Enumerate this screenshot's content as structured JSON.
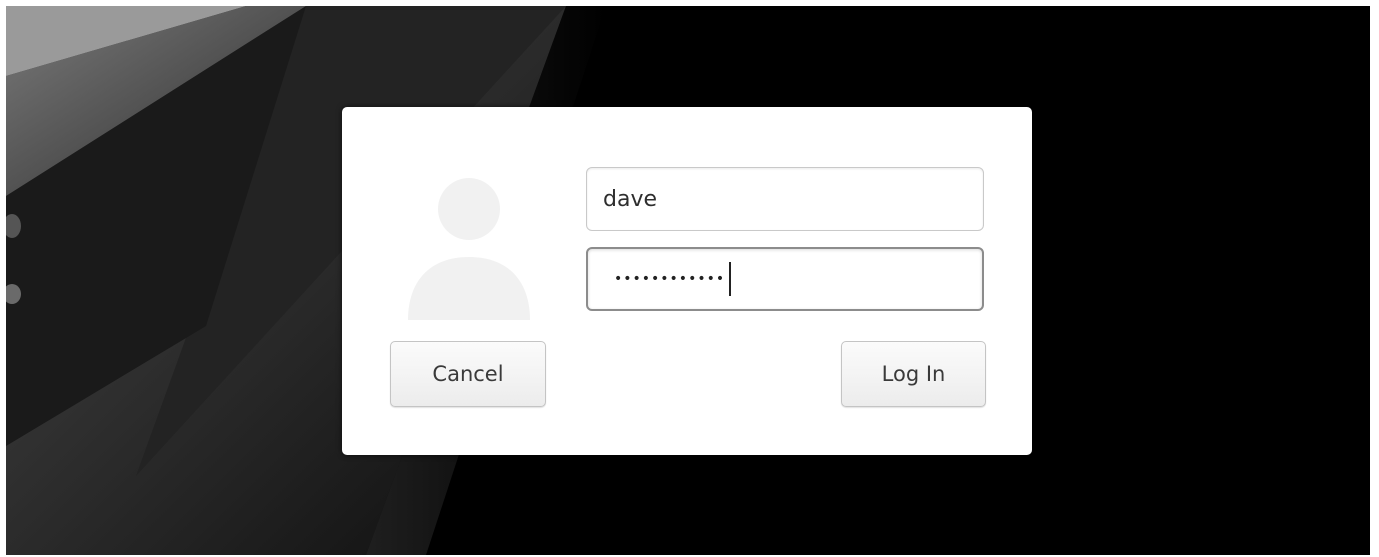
{
  "login_dialog": {
    "username_value": "dave",
    "password_mask": "••••••••••••",
    "cancel_label": "Cancel",
    "login_label": "Log In"
  },
  "icons": {
    "avatar": "user-avatar-icon"
  },
  "colors": {
    "background": "#000000",
    "dialog": "#ffffff",
    "button_border": "#c4c4c4",
    "focused_field_border": "#8c8c8c"
  }
}
